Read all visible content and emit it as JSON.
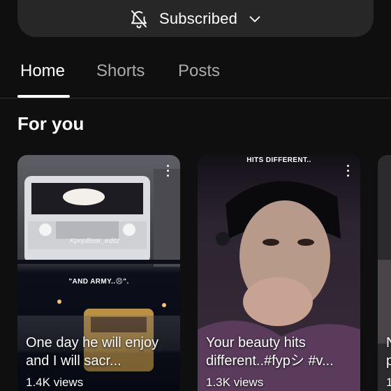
{
  "subscribe": {
    "label": "Subscribed"
  },
  "tabs": [
    {
      "label": "Home",
      "active": true
    },
    {
      "label": "Shorts",
      "active": false
    },
    {
      "label": "Posts",
      "active": false
    }
  ],
  "section": {
    "title": "For you"
  },
  "cards": [
    {
      "overlay_text": "\"AND ARMY..😣\".",
      "watermark": "KpopBear_editz",
      "title": "One day he will enjoy and I will sacr...",
      "views": "1.4K views"
    },
    {
      "overlay_text": "HITS DIFFERENT..",
      "title": "Your beauty hits different..#fypシ #v...",
      "views": "1.3K views"
    },
    {
      "title": "N p",
      "views": "1"
    }
  ],
  "icons": {
    "subscribe": "bell-off-icon",
    "dropdown": "chevron-down-icon",
    "more": "more-vert-icon"
  },
  "colors": {
    "background": "#0f0f0f",
    "button_bg": "#272727",
    "tab_inactive": "#aaaaaa",
    "divider": "#303030"
  }
}
